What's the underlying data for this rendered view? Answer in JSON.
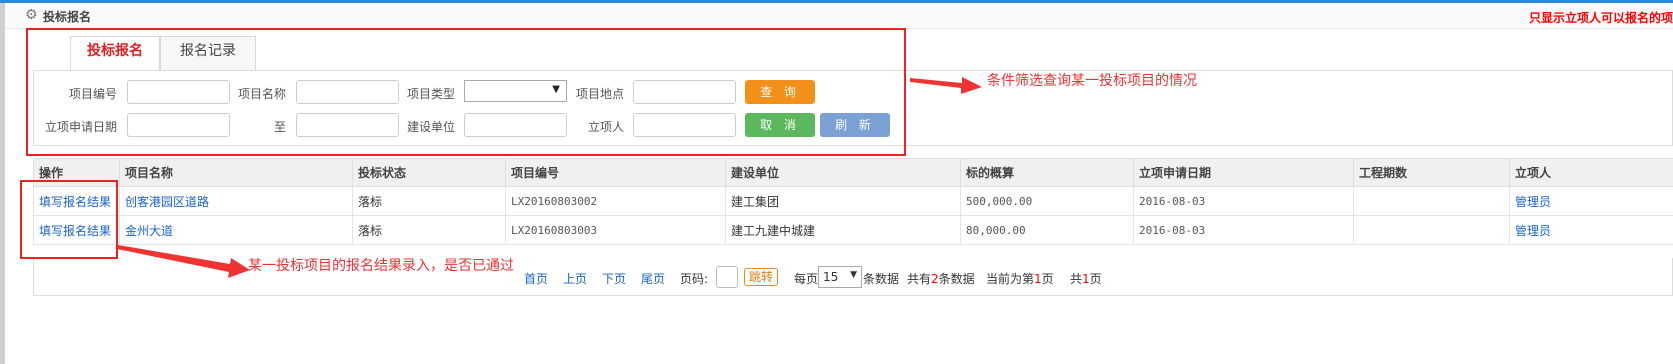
{
  "header": {
    "title": "投标报名",
    "note": "只显示立项人可以报名的项"
  },
  "tabs": [
    {
      "label": "投标报名",
      "active": true
    },
    {
      "label": "报名记录",
      "active": false
    }
  ],
  "search": {
    "project_no_label": "项目编号",
    "project_name_label": "项目名称",
    "project_type_label": "项目类型",
    "project_location_label": "项目地点",
    "apply_date_label": "立项申请日期",
    "to_label": "至",
    "builder_label": "建设单位",
    "initiator_label": "立项人",
    "query_button": "查 询",
    "cancel_button": "取 消",
    "refresh_button": "刷 新"
  },
  "annotations": {
    "filter_note": "条件筛选查询某一投标项目的情况",
    "result_note": "某一投标项目的报名结果录入，是否已通过"
  },
  "table": {
    "columns": [
      "操作",
      "项目名称",
      "投标状态",
      "项目编号",
      "建设单位",
      "标的概算",
      "立项申请日期",
      "工程期数",
      "立项人"
    ],
    "rows": [
      {
        "action": "填写报名结果",
        "name": "创客港园区道路",
        "status": "落标",
        "code": "LX20160803002",
        "builder": "建工集团",
        "estimate": "500,000.00",
        "date": "2016-08-03",
        "phases": "",
        "initiator": "管理员"
      },
      {
        "action": "填写报名结果",
        "name": "金州大道",
        "status": "落标",
        "code": "LX20160803003",
        "builder": "建工九建中城建",
        "estimate": "80,000.00",
        "date": "2016-08-03",
        "phases": "",
        "initiator": "管理员"
      }
    ]
  },
  "pager": {
    "first": "首页",
    "prev": "上页",
    "next": "下页",
    "last": "尾页",
    "page_label": "页码:",
    "jump": "跳转",
    "per_page_prefix": "每页",
    "per_page_value": "15",
    "per_page_suffix": "条数据",
    "total_prefix": "共有",
    "total_count": "2",
    "total_suffix": "条数据",
    "current_prefix": "当前为第",
    "current_page": "1",
    "current_suffix": "页",
    "pages_prefix": "共",
    "pages_count": "1",
    "pages_suffix": "页"
  },
  "colors": {
    "accent_blue": "#2a8ad8",
    "link": "#1a64c8",
    "annotation_red": "#ee2222",
    "query_orange": "#f39019",
    "cancel_green": "#5cb85c",
    "refresh_blue": "#7aa0d6"
  }
}
